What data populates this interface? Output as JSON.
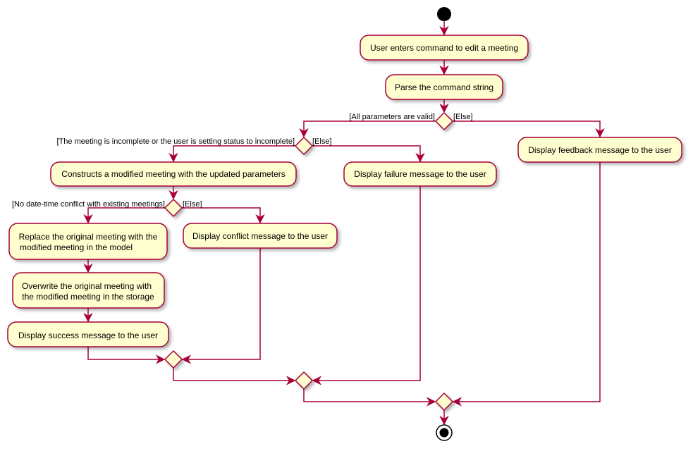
{
  "colors": {
    "border": "#A80036",
    "fill": "#FEFECE"
  },
  "activities": {
    "enter": "User enters command to edit a meeting",
    "parse": "Parse the command string",
    "feedback": "Display feedback message to the user",
    "construct": "Constructs a modified meeting with the updated parameters",
    "failure": "Display failure message to the user",
    "replace_1": "Replace the original meeting with the",
    "replace_2": "modified meeting in the model",
    "conflict": "Display conflict message to the user",
    "overwrite_1": "Overwrite the  original meeting with",
    "overwrite_2": "the modified meeting in the storage",
    "success": "Display success message to the user"
  },
  "guards": {
    "valid": "[All parameters are valid]",
    "valid_else": "[Else]",
    "incomplete": "[The meeting is incomplete or the user is setting status to incomplete]",
    "incomplete_else": "[Else]",
    "no_conflict": "[No date-time conflict with existing meetings]",
    "no_conflict_else": "[Else]"
  }
}
